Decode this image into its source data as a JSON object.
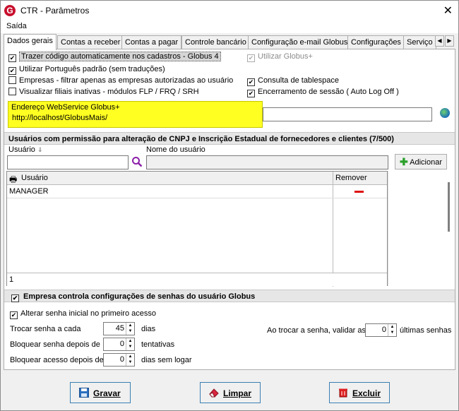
{
  "window": {
    "title": "CTR - Parâmetros",
    "logo": "G"
  },
  "menu": {
    "items": [
      {
        "label": "Saída"
      }
    ]
  },
  "tabs": [
    {
      "label": "Dados gerais",
      "active": true
    },
    {
      "label": "Contas a receber"
    },
    {
      "label": "Contas a pagar"
    },
    {
      "label": "Controle bancário"
    },
    {
      "label": "Configuração e-mail Globus"
    },
    {
      "label": "Configurações"
    },
    {
      "label": "Serviço"
    }
  ],
  "checkboxes": {
    "trazer_codigo": {
      "label": "Trazer código automaticamente nos cadastros - Globus 4",
      "checked": true
    },
    "utilizar_portugues": {
      "label": "Utilizar Português padrão (sem traduções)",
      "checked": true
    },
    "empresas_filtrar": {
      "label": "Empresas - filtrar apenas as empresas autorizadas ao usuário",
      "checked": false
    },
    "visualizar_filiais": {
      "label": "Visualizar filiais inativas - módulos FLP / FRQ / SRH",
      "checked": false
    },
    "utilizar_globus_plus": {
      "label": "Utilizar Globus+",
      "checked": true,
      "disabled": true
    },
    "consulta_tablespace": {
      "label": "Consulta de tablespace",
      "checked": true
    },
    "encerramento_sessao": {
      "label": "Encerramento de sessão ( Auto Log Off )",
      "checked": true
    }
  },
  "webservice": {
    "label": "Endereço WebService Globus+",
    "value": "http://localhost/GlobusMais/"
  },
  "usuarios_section": {
    "title": "Usuários com permissão para alteração de CNPJ e Inscrição Estadual de fornecedores e clientes (7/500)",
    "usuario_label": "Usuário",
    "nome_label": "Nome do usuário",
    "add_button": "Adicionar",
    "grid": {
      "col_usuario": "Usuário",
      "col_remover": "Remover",
      "rows": [
        {
          "usuario": "MANAGER"
        }
      ],
      "footer_count": "1"
    }
  },
  "senha_section": {
    "title": "Empresa controla configurações de senhas do usuário Globus",
    "checked": true,
    "alterar_senha": {
      "label": "Alterar senha inicial no primeiro acesso",
      "checked": true
    },
    "trocar_senha": {
      "label": "Trocar senha a cada",
      "value": "45",
      "unit": "dias"
    },
    "bloquear_senha": {
      "label": "Bloquear senha depois de",
      "value": "0",
      "unit": "tentativas"
    },
    "bloquear_acesso": {
      "label": "Bloquear acesso depois de",
      "value": "0",
      "unit": "dias sem logar"
    },
    "validar": {
      "label": "Ao trocar a senha, validar as",
      "value": "0",
      "unit": "últimas senhas"
    }
  },
  "footer": {
    "gravar": "Gravar",
    "limpar": "Limpar",
    "excluir": "Excluir"
  }
}
